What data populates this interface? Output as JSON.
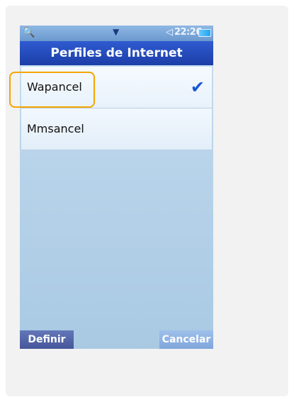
{
  "status_bar": {
    "search_icon": "search-icon",
    "menu_icon": "chevron-down-icon",
    "speaker_icon": "speaker-icon",
    "time": "22:26",
    "battery_icon": "battery-icon"
  },
  "title": "Perfiles de Internet",
  "profiles": [
    {
      "label": "Wapancel",
      "selected": true
    },
    {
      "label": "Mmsancel",
      "selected": false
    }
  ],
  "softkeys": {
    "left": "Definir",
    "right": "Cancelar"
  },
  "colors": {
    "title_bar": "#1c3ea8",
    "check": "#1557d6",
    "focus_ring": "#f5a500",
    "left_softkey": "#45569a",
    "right_softkey": "#7fa6dc"
  }
}
